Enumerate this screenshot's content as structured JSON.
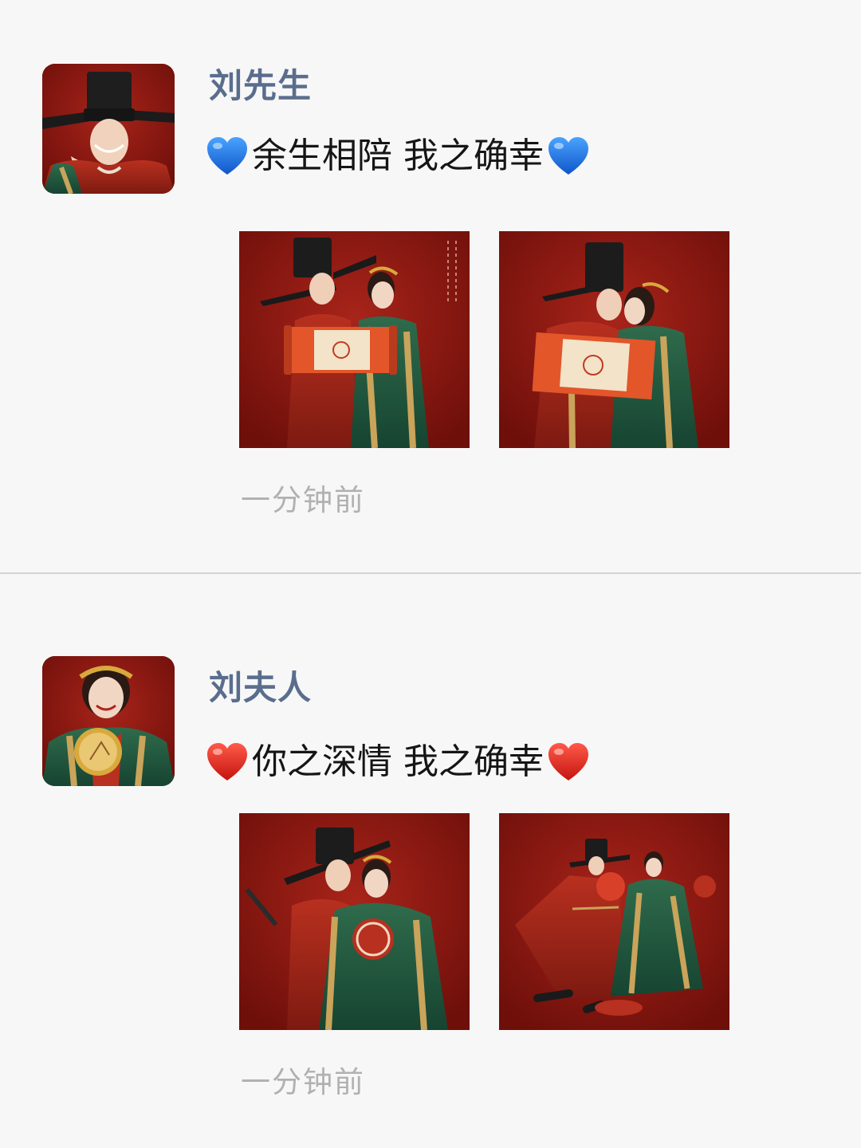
{
  "posts": [
    {
      "author": "刘先生",
      "caption": "余生相陪 我之确幸",
      "heart_color": "#1f6fe0",
      "heart_icon": "blue-heart-emoji",
      "images": [
        "groom-bride-scroll-photo",
        "groom-bride-scroll-nuzzle-photo"
      ],
      "timestamp": "一分钟前"
    },
    {
      "author": "刘夫人",
      "caption": "你之深情 我之确幸",
      "heart_color": "#e0261e",
      "heart_icon": "red-heart-emoji",
      "images": [
        "groom-bride-fan-photo",
        "groom-bride-dancing-photo"
      ],
      "timestamp": "一分钟前"
    }
  ],
  "colors": {
    "background": "#f7f7f7",
    "author_name": "#5a6d8d",
    "timestamp": "#b1b1b1",
    "photo_backdrop": "#8f1a12"
  }
}
